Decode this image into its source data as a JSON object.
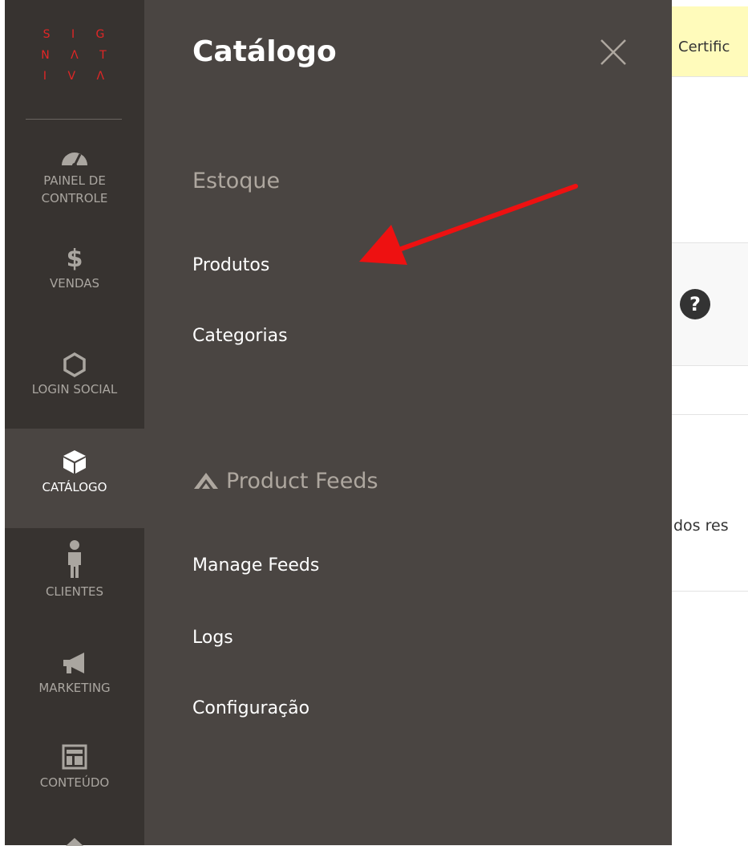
{
  "background": {
    "notice_text": "Certific",
    "partial_text": "dos res",
    "help_icon": "question-mark-icon"
  },
  "logo": {
    "lines": [
      "S I G",
      "N Λ T",
      "I V Λ"
    ],
    "color": "#e22626"
  },
  "left_nav": {
    "items": [
      {
        "label_line1": "PAINEL DE",
        "label_line2": "CONTROLE",
        "icon": "dashboard-gauge-icon"
      },
      {
        "label": "VENDAS",
        "icon": "dollar-icon"
      },
      {
        "label": "LOGIN SOCIAL",
        "icon": "hexagon-icon"
      },
      {
        "label": "CATÁLOGO",
        "icon": "box-icon",
        "active": true
      },
      {
        "label": "CLIENTES",
        "icon": "person-icon"
      },
      {
        "label": "MARKETING",
        "icon": "megaphone-icon"
      },
      {
        "label": "CONTEÚDO",
        "icon": "layout-icon"
      }
    ]
  },
  "flyout": {
    "title": "Catálogo",
    "close_icon": "close-icon",
    "sections": [
      {
        "title": "Estoque",
        "items": [
          "Produtos",
          "Categorias"
        ]
      },
      {
        "title": "Product Feeds",
        "icon": "feed-chevron-icon",
        "items": [
          "Manage Feeds",
          "Logs",
          "Configuração"
        ]
      }
    ]
  },
  "annotation": {
    "arrow_color": "#ee1111",
    "arrow_icon": "red-arrow-annotation"
  },
  "colors": {
    "nav_bg": "#373330",
    "flyout_bg": "#4a4542",
    "section_title": "#aea79f",
    "notice_bg": "#fffbbb"
  }
}
